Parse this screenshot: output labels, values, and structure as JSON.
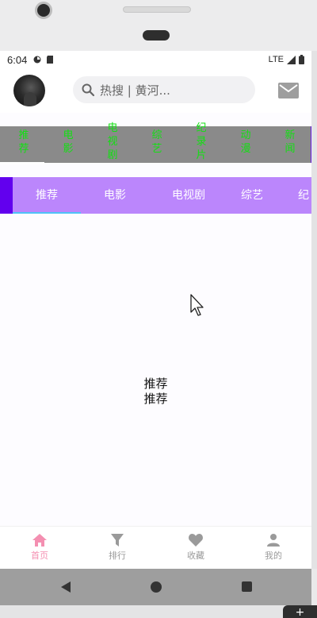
{
  "status_bar": {
    "time": "6:04",
    "network": "LTE"
  },
  "header": {
    "search_placeholder": "热搜 | 黄河..."
  },
  "top_strip": {
    "items": [
      "推荐",
      "电影",
      "电视剧",
      "综艺",
      "纪录片",
      "动漫",
      "新闻"
    ]
  },
  "tabs": {
    "items": [
      "推荐",
      "电影",
      "电视剧",
      "综艺",
      "纪"
    ],
    "selected": "推荐"
  },
  "content": {
    "line1": "推荐",
    "line2": "推荐"
  },
  "bottom_nav": {
    "items": [
      {
        "label": "首页",
        "icon": "home-icon",
        "active": true
      },
      {
        "label": "排行",
        "icon": "filter-icon",
        "active": false
      },
      {
        "label": "收藏",
        "icon": "heart-icon",
        "active": false
      },
      {
        "label": "我的",
        "icon": "person-icon",
        "active": false
      }
    ]
  },
  "colors": {
    "tab_bar": "#bb86fc",
    "tab_edge": "#6200ee",
    "indicator": "#4fc3f7",
    "strip_bg": "#8a8a8a",
    "strip_text": "#12e012",
    "active_nav": "#f48fb1"
  },
  "corner_button": "+"
}
